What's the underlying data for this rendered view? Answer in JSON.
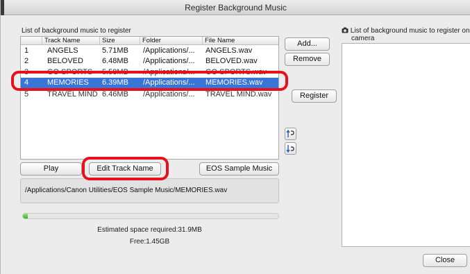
{
  "window": {
    "title": "Register Background Music"
  },
  "left_list": {
    "label": "List of background music to register",
    "columns": [
      "",
      "Track Name",
      "Size",
      "Folder",
      "File Name"
    ],
    "rows": [
      {
        "num": "1",
        "track": "ANGELS",
        "size": "5.71MB",
        "folder": "/Applications/...",
        "file": "ANGELS.wav"
      },
      {
        "num": "2",
        "track": "BELOVED",
        "size": "6.48MB",
        "folder": "/Applications/...",
        "file": "BELOVED.wav"
      },
      {
        "num": "3",
        "track": "GO SPORTS",
        "size": "5.58MB",
        "folder": "/Applications/...",
        "file": "GO SPORTS.wav"
      },
      {
        "num": "4",
        "track": "MEMORIES",
        "size": "6.39MB",
        "folder": "/Applications/...",
        "file": "MEMORIES.wav"
      },
      {
        "num": "5",
        "track": "TRAVEL MIND",
        "size": "6.46MB",
        "folder": "/Applications/...",
        "file": "TRAVEL MIND.wav"
      }
    ],
    "selected_index": 3
  },
  "buttons": {
    "add": "Add...",
    "remove": "Remove",
    "register": "Register",
    "play": "Play",
    "edit_track_name": "Edit Track Name",
    "eos_sample_music": "EOS Sample Music",
    "close": "Close"
  },
  "path_text": "/Applications/Canon Utilities/EOS Sample Music/MEMORIES.wav",
  "progress": {
    "fraction": 0.02
  },
  "estimated_space": "Estimated space required:31.9MB",
  "free_space": "Free:1.45GB",
  "right_list": {
    "label_line1": "List of background music to register on",
    "label_line2": "camera"
  },
  "icons": {
    "camera": "camera-icon",
    "move_up": "move-up-icon",
    "move_down": "move-down-icon"
  },
  "colors": {
    "selection": "#3875d7",
    "highlight": "#e8101a",
    "progress": "#3fae2a"
  }
}
